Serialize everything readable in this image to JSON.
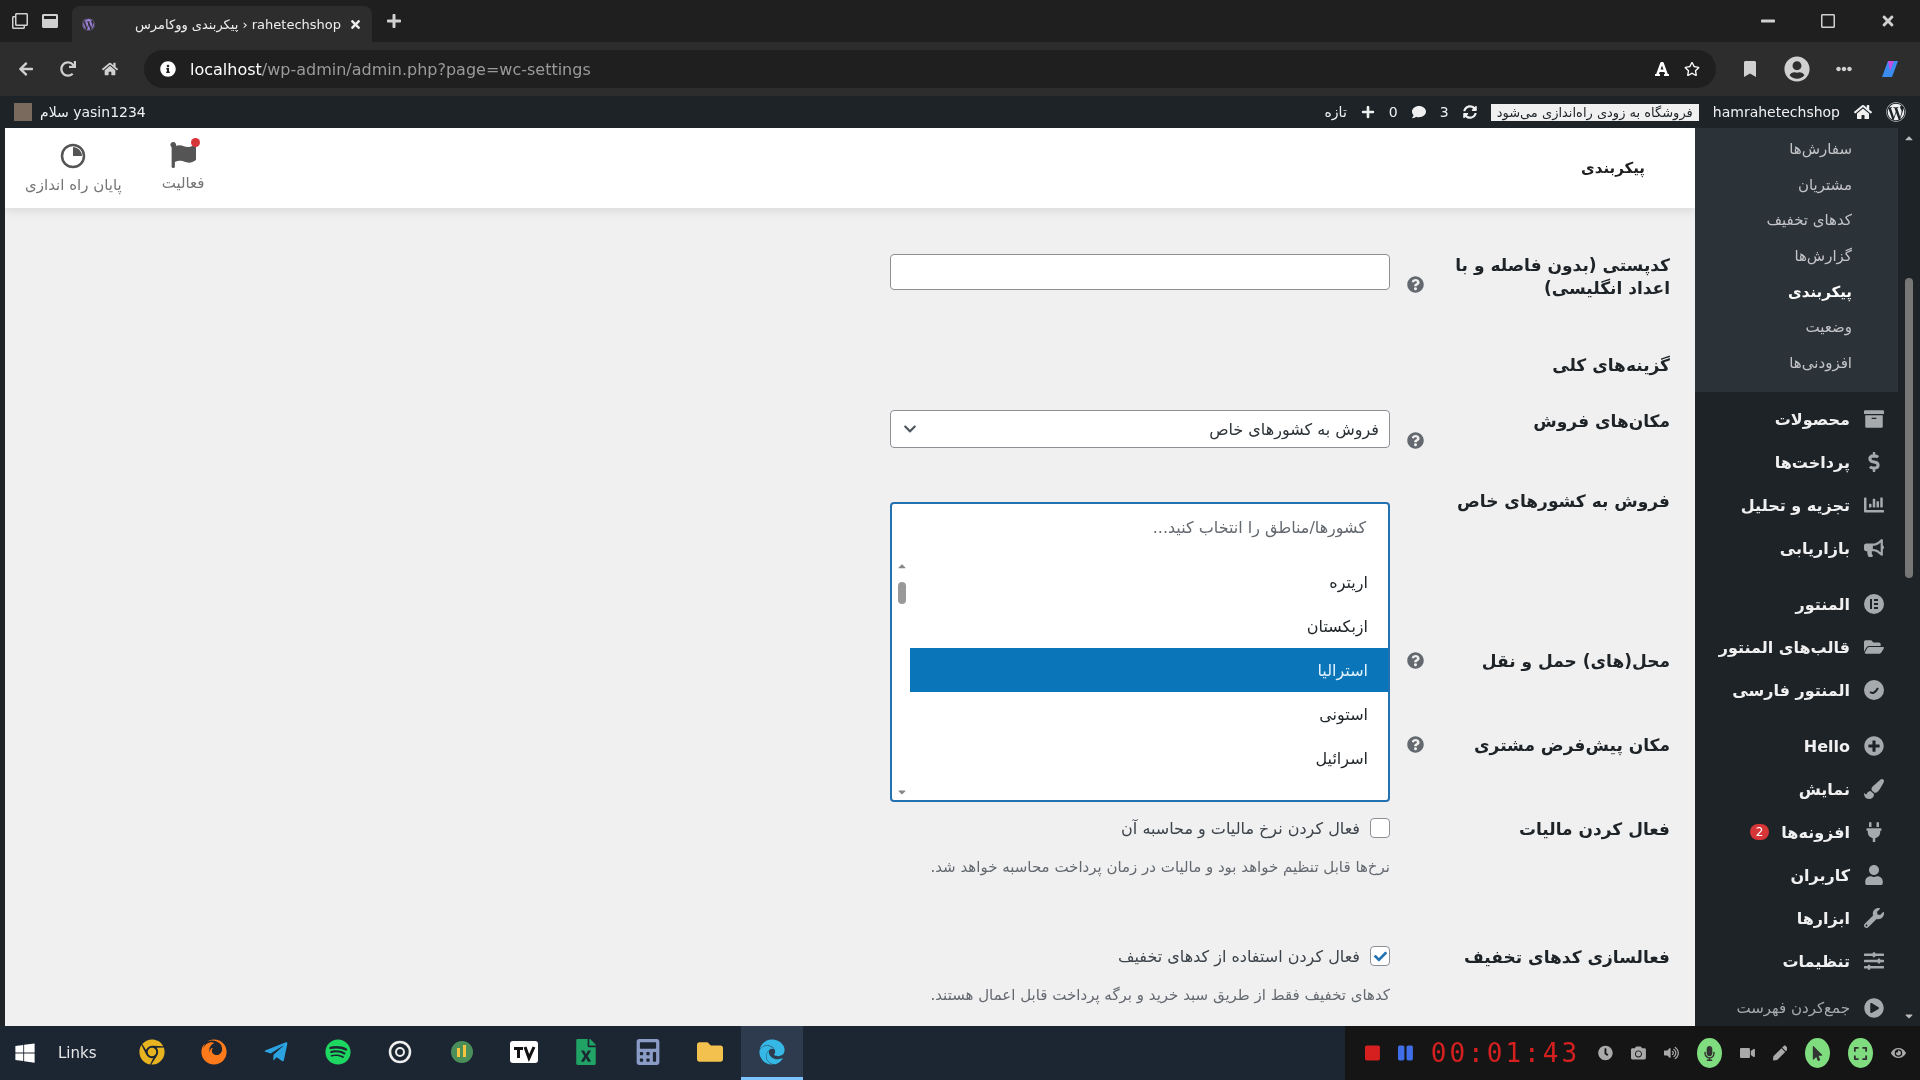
{
  "browser": {
    "tab_title": "rahetechshop ‹ پیکربندی ووکامرس",
    "url_host": "localhost",
    "url_path": "/wp-admin/admin.php?page=wc-settings"
  },
  "admin_bar": {
    "site_name": "hamrahetechshop",
    "store_notice": "فروشگاه به زودی راه‌اندازی می‌شود",
    "updates": "3",
    "comments": "0",
    "new": "تازه",
    "greeting": "سلام yasin1234"
  },
  "header": {
    "title": "پیکربندی",
    "actions": [
      {
        "label": "فعالیت",
        "kind": "activity",
        "unread": true
      },
      {
        "label": "پایان راه اندازی",
        "kind": "setup",
        "unread": false
      }
    ]
  },
  "form": {
    "rows": [
      {
        "kind": "text",
        "label": "کدپستی (بدون فاصله و با اعداد انگلیسی)",
        "help": true
      },
      {
        "kind": "heading",
        "label": "گزینه‌های کلی",
        "help": false
      },
      {
        "kind": "select",
        "label": "مکان‌های فروش",
        "help": true,
        "value": "فروش به کشورهای خاص"
      },
      {
        "kind": "multiselect",
        "label": "فروش به کشورهای خاص",
        "help": false,
        "placeholder": "کشورها/مناطق را انتخاب کنید...",
        "options": [
          {
            "label": "اریتره",
            "selected": false
          },
          {
            "label": "ازبکستان",
            "selected": false
          },
          {
            "label": "استرالیا",
            "selected": true
          },
          {
            "label": "استونی",
            "selected": false
          },
          {
            "label": "اسرائیل",
            "selected": false
          }
        ]
      },
      {
        "kind": "plain",
        "label": "محل(های) حمل و نقل",
        "help": true
      },
      {
        "kind": "plain",
        "label": "مکان پیش‌فرض مشتری",
        "help": true
      },
      {
        "kind": "checkbox",
        "label": "فعال کردن مالیات",
        "help": false,
        "text": "فعال کردن نرخ مالیات و محاسبه آن",
        "checked": false,
        "description": "نرخ‌ها قابل تنظیم خواهد بود و مالیات در زمان پرداخت محاسبه خواهد شد."
      },
      {
        "kind": "checkbox",
        "label": "فعالسازی کدهای تخفیف",
        "help": false,
        "text": "فعال کردن استفاده از کدهای تخفیف",
        "checked": true,
        "description": "کدهای تخفیف فقط از طریق سبد خرید و برگه پرداخت قابل اعمال هستند."
      }
    ]
  },
  "sidebar": {
    "submenu": [
      {
        "label": "سفارش‌ها",
        "selected": false
      },
      {
        "label": "مشتریان",
        "selected": false
      },
      {
        "label": "کدهای تخفیف",
        "selected": false
      },
      {
        "label": "گزارش‌ها",
        "selected": false
      },
      {
        "label": "پیکربندی",
        "selected": true
      },
      {
        "label": "وضعیت",
        "selected": false
      },
      {
        "label": "افزودنی‌ها",
        "selected": false
      }
    ],
    "groups": [
      {
        "items": [
          {
            "label": "محصولات",
            "kind": "products"
          },
          {
            "label": "پرداخت‌ها",
            "kind": "payments"
          },
          {
            "label": "تجزیه و تحلیل",
            "kind": "analytics"
          },
          {
            "label": "بازاریابی",
            "kind": "marketing"
          }
        ]
      },
      {
        "items": [
          {
            "label": "المنتور",
            "kind": "elementor"
          },
          {
            "label": "قالب‌های المنتور",
            "kind": "templates"
          },
          {
            "label": "المنتور فارسی",
            "kind": "elementor-fa"
          }
        ]
      },
      {
        "items": [
          {
            "label": "Hello",
            "kind": "hello"
          },
          {
            "label": "نمایش",
            "kind": "appearance"
          },
          {
            "label": "افزونه‌ها",
            "kind": "plugins",
            "badge": "2"
          },
          {
            "label": "کاربران",
            "kind": "users"
          },
          {
            "label": "ابزارها",
            "kind": "tools"
          },
          {
            "label": "تنظیمات",
            "kind": "settings"
          }
        ]
      }
    ],
    "collapse": "جمع‌کردن فهرست"
  },
  "taskbar": {
    "links": "Links",
    "apps": [
      {
        "kind": "chrome",
        "active": false
      },
      {
        "kind": "firefox",
        "active": false
      },
      {
        "kind": "telegram",
        "active": false
      },
      {
        "kind": "spotify",
        "active": false
      },
      {
        "kind": "chatgpt",
        "active": false
      },
      {
        "kind": "trader",
        "active": false
      },
      {
        "kind": "tradingview",
        "active": false
      },
      {
        "kind": "excel",
        "active": false
      },
      {
        "kind": "calculator",
        "active": false
      },
      {
        "kind": "explorer",
        "active": false
      },
      {
        "kind": "edge",
        "active": true
      }
    ],
    "recorder_time": "00:01:43"
  }
}
